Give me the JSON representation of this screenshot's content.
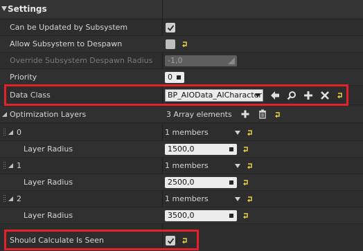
{
  "header": {
    "title": "Settings"
  },
  "rows": {
    "can_be_updated": {
      "label": "Can be Updated by Subsystem",
      "checked": true
    },
    "allow_despawn": {
      "label": "Allow Subsystem to Despawn",
      "checked": false
    },
    "override_radius": {
      "label": "Override Subsystem Despawn Radius",
      "value": "-1,0"
    },
    "priority": {
      "label": "Priority",
      "value": "0"
    },
    "data_class": {
      "label": "Data Class",
      "value": "BP_AIOData_AICharacter"
    },
    "optimization_layers": {
      "label": "Optimization Layers",
      "count": "3 Array elements"
    },
    "layers": [
      {
        "index": "0",
        "members": "1 members",
        "radius_label": "Layer Radius",
        "radius": "1500,0"
      },
      {
        "index": "1",
        "members": "1 members",
        "radius_label": "Layer Radius",
        "radius": "2500,0"
      },
      {
        "index": "2",
        "members": "1 members",
        "radius_label": "Layer Radius",
        "radius": "3500,0"
      }
    ],
    "should_calculate": {
      "label": "Should Calculate Is Seen",
      "checked": true
    }
  },
  "colors": {
    "highlight": "#e8202a",
    "reset_arrow": "#e8d23a",
    "panel_bg": "#2d2d2d"
  },
  "icons": {
    "use_selected": "arrow-left-icon",
    "browse": "search-icon",
    "add": "plus-icon",
    "clear": "close-icon",
    "reset": "reset-arrow-icon",
    "delete": "trash-icon"
  }
}
